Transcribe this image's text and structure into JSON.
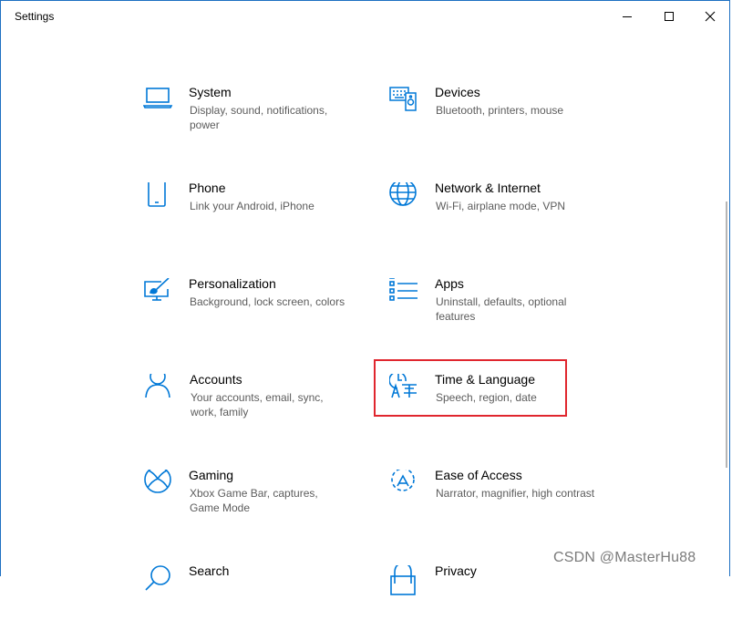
{
  "window": {
    "title": "Settings",
    "accent": "#0078d7",
    "highlight_color": "#e0262e"
  },
  "items": [
    {
      "name": "System",
      "desc": "Display, sound, notifications, power",
      "icon": "laptop-icon"
    },
    {
      "name": "Devices",
      "desc": "Bluetooth, printers, mouse",
      "icon": "keyboard-speaker-icon"
    },
    {
      "name": "Phone",
      "desc": "Link your Android, iPhone",
      "icon": "phone-icon"
    },
    {
      "name": "Network & Internet",
      "desc": "Wi-Fi, airplane mode, VPN",
      "icon": "globe-icon"
    },
    {
      "name": "Personalization",
      "desc": "Background, lock screen, colors",
      "icon": "paintbrush-icon"
    },
    {
      "name": "Apps",
      "desc": "Uninstall, defaults, optional features",
      "icon": "apps-list-icon"
    },
    {
      "name": "Accounts",
      "desc": "Your accounts, email, sync, work, family",
      "icon": "person-icon"
    },
    {
      "name": "Time & Language",
      "desc": "Speech, region, date",
      "icon": "time-language-icon"
    },
    {
      "name": "Gaming",
      "desc": "Xbox Game Bar, captures, Game Mode",
      "icon": "xbox-icon"
    },
    {
      "name": "Ease of Access",
      "desc": "Narrator, magnifier, high contrast",
      "icon": "ease-of-access-icon"
    },
    {
      "name": "Search",
      "desc": "",
      "icon": "search-icon"
    },
    {
      "name": "Privacy",
      "desc": "",
      "icon": "lock-icon"
    }
  ],
  "watermark": "CSDN @MasterHu88"
}
